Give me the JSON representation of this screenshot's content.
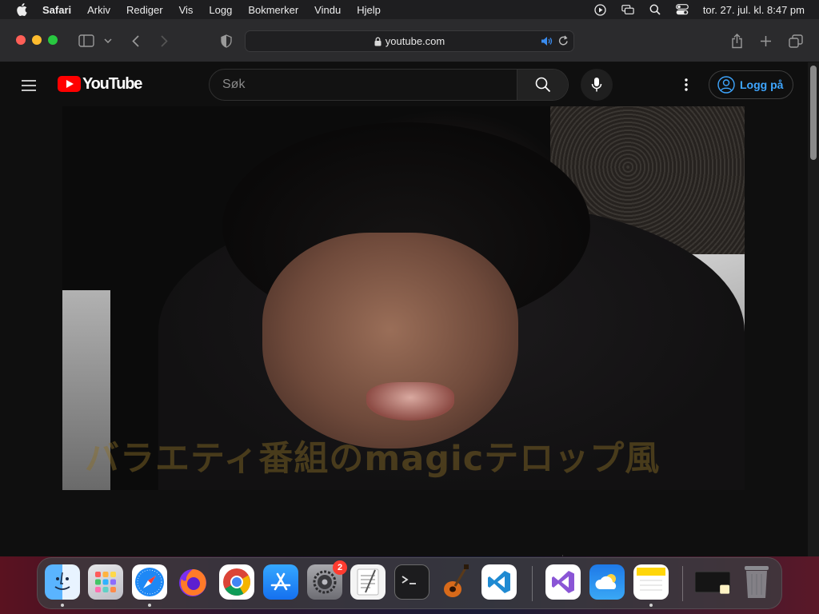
{
  "menubar": {
    "app_name": "Safari",
    "items": [
      "Arkiv",
      "Rediger",
      "Vis",
      "Logg",
      "Bokmerker",
      "Vindu",
      "Hjelp"
    ],
    "clock": "tor. 27. jul. kl. 8:47 pm"
  },
  "safari": {
    "address": "youtube.com"
  },
  "youtube": {
    "logo_text": "YouTube",
    "search_placeholder": "Søk",
    "login_label": "Logg på"
  },
  "video": {
    "caption": "バラエティ番組のmagicテロップ風"
  },
  "dock": {
    "apps": [
      "finder",
      "launchpad",
      "safari",
      "firefox",
      "chrome",
      "app-store",
      "system-settings",
      "textedit",
      "terminal",
      "garageband",
      "vscode",
      "visual-studio",
      "weather",
      "notes",
      "window-preview",
      "trash"
    ],
    "system_settings_badge": "2"
  },
  "colors": {
    "youtube_red": "#ff0000",
    "link_blue": "#3ea6ff",
    "badge_red": "#ff3b30"
  }
}
